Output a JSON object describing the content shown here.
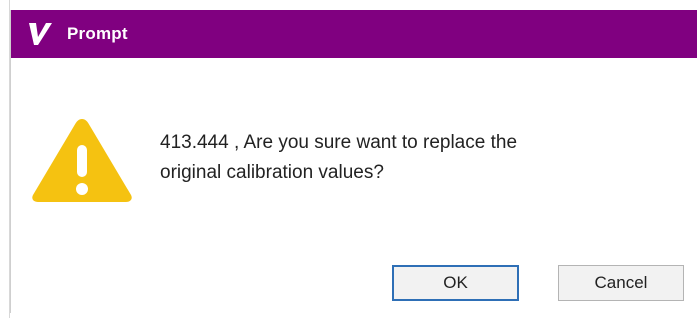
{
  "window": {
    "title": "Prompt",
    "logo_icon": "v-logo-icon",
    "titlebar_color": "#800080"
  },
  "dialog": {
    "icon": "warning-icon",
    "message_line1": "413.444 , Are you sure want to replace the",
    "message_line2": "original calibration values?"
  },
  "buttons": {
    "ok_label": "OK",
    "cancel_label": "Cancel"
  }
}
